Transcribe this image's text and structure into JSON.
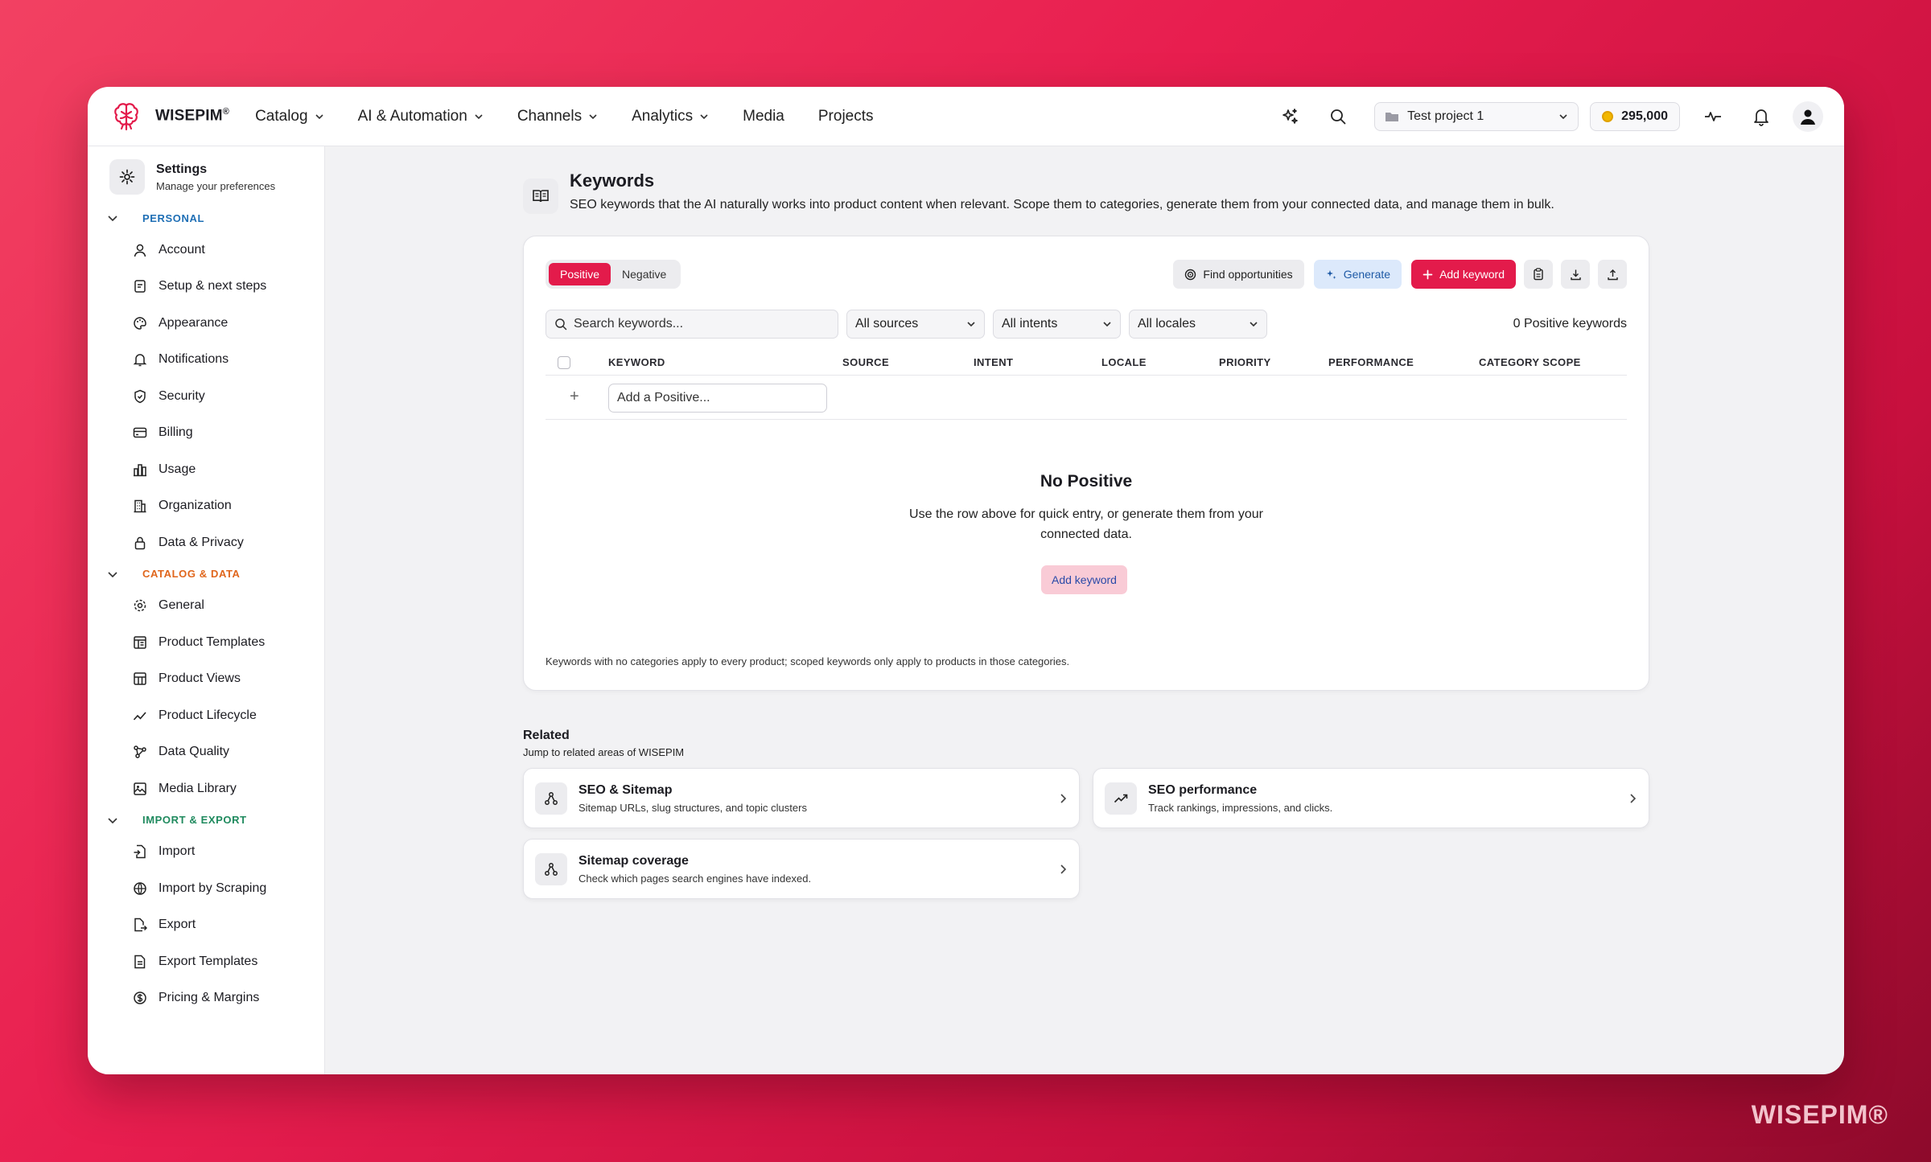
{
  "brand": {
    "name": "WISEPIM",
    "mark": "®"
  },
  "nav": {
    "items": [
      {
        "label": "Catalog",
        "dropdown": true
      },
      {
        "label": "AI & Automation",
        "dropdown": true
      },
      {
        "label": "Channels",
        "dropdown": true
      },
      {
        "label": "Analytics",
        "dropdown": true
      },
      {
        "label": "Media",
        "dropdown": false
      },
      {
        "label": "Projects",
        "dropdown": false
      }
    ],
    "project": "Test project 1",
    "credits": "295,000"
  },
  "sidebar": {
    "title": "Settings",
    "subtitle": "Manage your preferences",
    "sections": [
      {
        "label": "PERSONAL",
        "color": "#1f6fb5",
        "items": [
          "Account",
          "Setup & next steps",
          "Appearance",
          "Notifications",
          "Security",
          "Billing",
          "Usage",
          "Organization",
          "Data & Privacy"
        ]
      },
      {
        "label": "CATALOG & DATA",
        "color": "#e0661c",
        "items": [
          "General",
          "Product Templates",
          "Product Views",
          "Product Lifecycle",
          "Data Quality",
          "Media Library"
        ]
      },
      {
        "label": "IMPORT & EXPORT",
        "color": "#1f8a5e",
        "items": [
          "Import",
          "Import by Scraping",
          "Export",
          "Export Templates",
          "Pricing & Margins"
        ]
      }
    ]
  },
  "page": {
    "title": "Keywords",
    "description": "SEO keywords that the AI naturally works into product content when relevant. Scope them to categories, generate them from your connected data, and manage them in bulk."
  },
  "tabs": {
    "positive": "Positive",
    "negative": "Negative",
    "active": "positive"
  },
  "toolbar": {
    "find": "Find opportunities",
    "generate": "Generate",
    "add": "Add keyword"
  },
  "filters": {
    "search_placeholder": "Search keywords...",
    "sources": "All sources",
    "intents": "All intents",
    "locales": "All locales",
    "count": "0 Positive keywords"
  },
  "table": {
    "columns": [
      "KEYWORD",
      "SOURCE",
      "INTENT",
      "LOCALE",
      "PRIORITY",
      "PERFORMANCE",
      "CATEGORY SCOPE"
    ],
    "add_placeholder": "Add a Positive..."
  },
  "empty": {
    "title": "No Positive",
    "line1": "Use the row above for quick entry, or generate them from your",
    "line2": "connected data.",
    "button": "Add keyword"
  },
  "footnote": "Keywords with no categories apply to every product; scoped keywords only apply to products in those categories.",
  "related": {
    "title": "Related",
    "subtitle": "Jump to related areas of WISEPIM",
    "cards": [
      {
        "title": "SEO & Sitemap",
        "subtitle": "Sitemap URLs, slug structures, and topic clusters",
        "icon": "sitemap-icon"
      },
      {
        "title": "SEO performance",
        "subtitle": "Track rankings, impressions, and clicks.",
        "icon": "trend-up-icon"
      },
      {
        "title": "Sitemap coverage",
        "subtitle": "Check which pages search engines have indexed.",
        "icon": "sitemap-icon"
      }
    ]
  },
  "watermark": "WISEPIM®"
}
